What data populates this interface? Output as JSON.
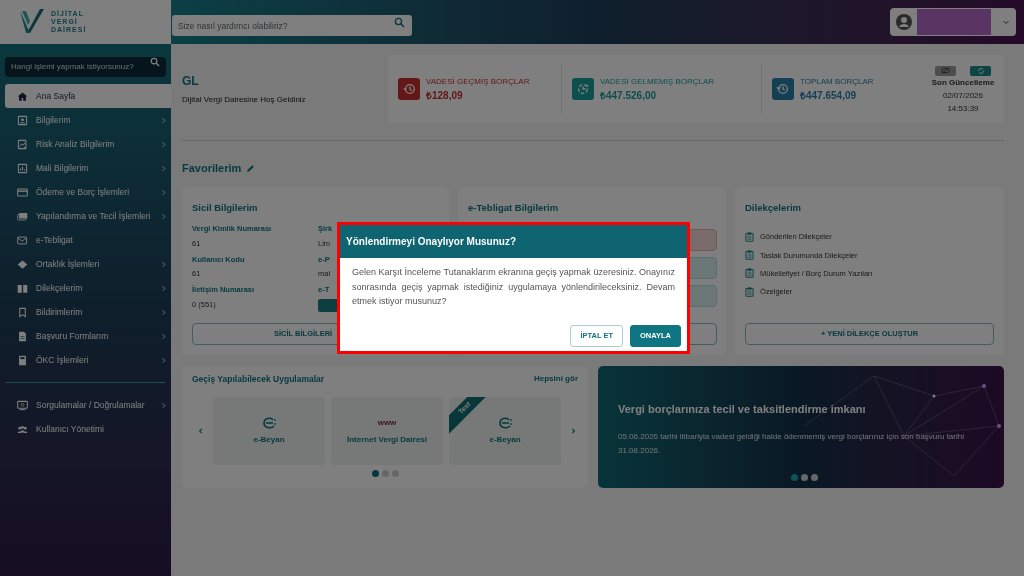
{
  "logo": {
    "lines": [
      "DİJİTAL",
      "VERGİ",
      "DAİRESİ"
    ]
  },
  "header": {
    "search": {
      "placeholder": "Size nasıl yardımcı olabiliriz?"
    }
  },
  "sidebar": {
    "search": {
      "placeholder": "Hangi işlemi yapmak istiyorsunuz?"
    },
    "items": [
      {
        "label": "Ana Sayfa",
        "selected": true,
        "expandable": false
      },
      {
        "label": "Bilgilerim",
        "selected": false,
        "expandable": true
      },
      {
        "label": "Risk Analiz Bilgilerim",
        "selected": false,
        "expandable": true
      },
      {
        "label": "Mali Bilgilerim",
        "selected": false,
        "expandable": true
      },
      {
        "label": "Ödeme ve Borç İşlemleri",
        "selected": false,
        "expandable": true
      },
      {
        "label": "Yapılandırma ve Tecil İşlemleri",
        "selected": false,
        "expandable": true
      },
      {
        "label": "e-Tebligat",
        "selected": false,
        "expandable": false
      },
      {
        "label": "Ortaklık İşlemleri",
        "selected": false,
        "expandable": true
      },
      {
        "label": "Dilekçelerim",
        "selected": false,
        "expandable": true
      },
      {
        "label": "Bildirimlerim",
        "selected": false,
        "expandable": true
      },
      {
        "label": "Başvuru Formlarım",
        "selected": false,
        "expandable": true
      },
      {
        "label": "ÖKC İşlemleri",
        "selected": false,
        "expandable": true
      }
    ],
    "footer_items": [
      {
        "label": "Sorgulamalar / Doğrulamalar",
        "selected": false,
        "expandable": true
      },
      {
        "label": "Kullanıcı Yönetimi",
        "selected": false,
        "expandable": false
      }
    ]
  },
  "welcome": {
    "name": "GL",
    "message": "Dijital Vergi Dairesine Hoş Geldiniz"
  },
  "debts": [
    {
      "kind": "overdue",
      "label": "VADESİ GEÇMİŞ BORÇLAR",
      "amount": "₺128,09"
    },
    {
      "kind": "not_due",
      "label": "VADESİ GELMEMİŞ BORÇLAR",
      "amount": "₺447.526,00"
    },
    {
      "kind": "total",
      "label": "TOPLAM BORÇLAR",
      "amount": "₺447.654,09"
    }
  ],
  "last_update": {
    "label": "Son Güncelleme",
    "date": "02/07/2026",
    "time": "14:53:39"
  },
  "favorites": {
    "title": "Favorilerim"
  },
  "sicil_card": {
    "title": "Sicil Bilgilerim",
    "fields": [
      {
        "label": "Vergi Kimlik Numarası",
        "value": "61"
      },
      {
        "label": "Kullanıcı Kodu",
        "value": "61"
      },
      {
        "label": "İletişim Numarası",
        "value": "0 (551)"
      }
    ],
    "fields_2": [
      {
        "kind": "text",
        "label": "Şirk",
        "value": "Lim"
      },
      {
        "kind": "text",
        "label": "e-P",
        "value": "mal"
      },
      {
        "kind": "button",
        "label": "e-T"
      }
    ],
    "button": "SİCİL BİLGİLERİ"
  },
  "tebligat_card": {
    "title": "e-Tebligat Bilgilerim",
    "panels": [
      {
        "kind": "alert"
      },
      {
        "kind": "info"
      },
      {
        "kind": "info"
      }
    ]
  },
  "dilekce_card": {
    "title": "Dilekçelerim",
    "items": [
      "Gönderilen Dilekçeler",
      "Taslak Durumunda Dilekçeler",
      "Mükellefiyet / Borç Durum Yazıları",
      "Özelgeler"
    ],
    "button": "+ YENİ DİLEKÇE OLUŞTUR"
  },
  "apps": {
    "title": "Geçiş Yapılabilecek Uygulamalar",
    "link": "Hepsini gör",
    "items": [
      {
        "kind": "ebeyan",
        "name": "e-Beyan"
      },
      {
        "kind": "www",
        "logo_text": "www",
        "name": "İnternet Vergi Dairesi"
      },
      {
        "kind": "ebeyan",
        "name": "e-Beyan",
        "ribbon": "Test"
      }
    ],
    "pages": [
      {
        "selected": true
      },
      {
        "selected": false
      },
      {
        "selected": false
      }
    ]
  },
  "banner": {
    "title": "Vergi borçlarınıza tecil ve taksitlendirme imkanı",
    "text": "05.06.2026 tarihi itibariyla vadesi geldiği halde ödenmemiş vergi borçlarınız için son başvuru tarihi 31.08.2026.",
    "pages": [
      {
        "selected": true
      },
      {
        "selected": false
      },
      {
        "selected": false
      }
    ]
  },
  "modal": {
    "title": "Yönlendirmeyi Onaylıyor Musunuz?",
    "message": "Gelen Karşıt İnceleme Tutanaklarım ekranına geçiş yapmak üzeresiniz. Onayınız sonrasında geçiş yapmak istediğiniz uygulamaya yönlendirileceksiniz. Devam etmek istiyor musunuz?",
    "buttons": [
      {
        "kind": "secondary",
        "label": "İPTAL ET"
      },
      {
        "kind": "primary",
        "label": "ONAYLA"
      }
    ]
  }
}
